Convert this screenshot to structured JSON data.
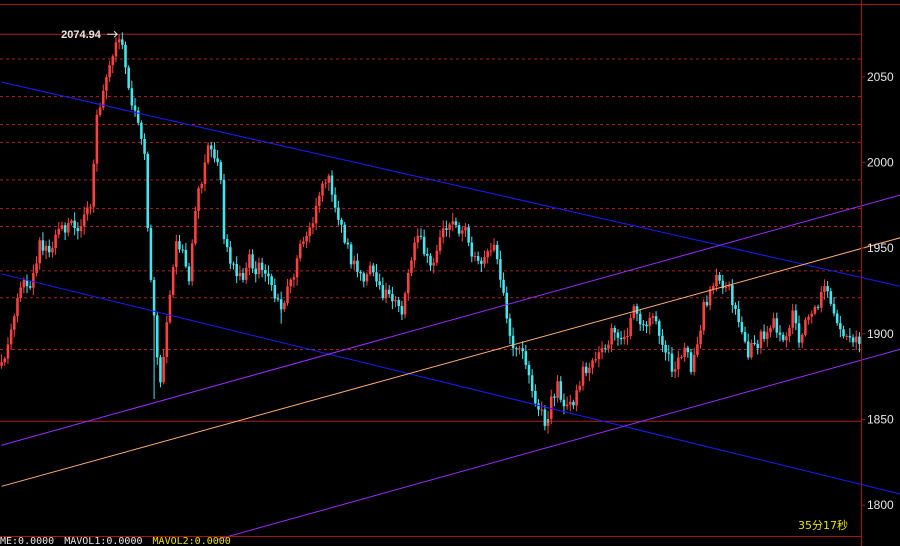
{
  "peak_label": "2074.94",
  "timer": "35分17秒",
  "status_items": [
    {
      "text": "ME:0.0000",
      "color": "#e6e6e6"
    },
    {
      "text": "MAVOL1:0.0000",
      "color": "#e6e6e6"
    },
    {
      "text": "MAVOL2:0.0000",
      "color": "#e8e100"
    }
  ],
  "colors": {
    "background": "#000000",
    "frame": "#aa1111",
    "grid": "#aa2222",
    "up_candle": "#ff4040",
    "down_candle": "#44e6ee",
    "down_channel": "#1a1aff",
    "up_channel": "#9a2bff",
    "mid_channel": "#ffb070"
  },
  "chart_data": {
    "type": "candlestick",
    "ylim": [
      1782,
      2092
    ],
    "y_ticks": [
      {
        "value": 2050,
        "label": "2050"
      },
      {
        "value": 2000,
        "label": "2000"
      },
      {
        "value": 1950,
        "label": "1950"
      },
      {
        "value": 1900,
        "label": "1900"
      },
      {
        "value": 1850,
        "label": "1850"
      },
      {
        "value": 1800,
        "label": "1800"
      }
    ],
    "solid_levels": [
      2074.94,
      1849
    ],
    "dotted_levels": [
      2060.5,
      2038.5,
      2022.2,
      2011.8,
      1989.9,
      1973.1,
      1962.7,
      1936.8,
      1921.1,
      1890.9
    ],
    "peak": {
      "index": 37,
      "value": 2074.94
    },
    "price_path": [
      [
        0,
        1882
      ],
      [
        3,
        1898
      ],
      [
        6,
        1930
      ],
      [
        9,
        1924
      ],
      [
        12,
        1952
      ],
      [
        15,
        1950
      ],
      [
        18,
        1958
      ],
      [
        21,
        1965
      ],
      [
        24,
        1962
      ],
      [
        26,
        1966
      ],
      [
        28,
        1975
      ],
      [
        30,
        2025
      ],
      [
        32,
        2045
      ],
      [
        34,
        2058
      ],
      [
        36,
        2066
      ],
      [
        37,
        2074.94
      ],
      [
        39,
        2058
      ],
      [
        41,
        2030
      ],
      [
        43,
        2025
      ],
      [
        45,
        2002
      ],
      [
        46,
        1960
      ],
      [
        48,
        1910
      ],
      [
        50,
        1870
      ],
      [
        52,
        1905
      ],
      [
        53,
        1925
      ],
      [
        55,
        1955
      ],
      [
        57,
        1945
      ],
      [
        59,
        1935
      ],
      [
        61,
        1975
      ],
      [
        63,
        1992
      ],
      [
        65,
        2012
      ],
      [
        67,
        2005
      ],
      [
        69,
        1990
      ],
      [
        70,
        1955
      ],
      [
        72,
        1940
      ],
      [
        74,
        1938
      ],
      [
        76,
        1932
      ],
      [
        78,
        1945
      ],
      [
        80,
        1935
      ],
      [
        82,
        1940
      ],
      [
        84,
        1930
      ],
      [
        86,
        1925
      ],
      [
        88,
        1913
      ],
      [
        90,
        1925
      ],
      [
        92,
        1935
      ],
      [
        94,
        1948
      ],
      [
        96,
        1960
      ],
      [
        98,
        1963
      ],
      [
        100,
        1980
      ],
      [
        102,
        1992
      ],
      [
        104,
        1985
      ],
      [
        106,
        1967
      ],
      [
        108,
        1955
      ],
      [
        110,
        1943
      ],
      [
        112,
        1937
      ],
      [
        114,
        1935
      ],
      [
        116,
        1938
      ],
      [
        118,
        1928
      ],
      [
        120,
        1920
      ],
      [
        122,
        1925
      ],
      [
        124,
        1922
      ],
      [
        126,
        1910
      ],
      [
        128,
        1934
      ],
      [
        130,
        1952
      ],
      [
        132,
        1955
      ],
      [
        134,
        1945
      ],
      [
        136,
        1940
      ],
      [
        138,
        1958
      ],
      [
        140,
        1962
      ],
      [
        142,
        1968
      ],
      [
        144,
        1962
      ],
      [
        146,
        1958
      ],
      [
        148,
        1945
      ],
      [
        150,
        1940
      ],
      [
        152,
        1945
      ],
      [
        154,
        1952
      ],
      [
        156,
        1945
      ],
      [
        157,
        1936
      ],
      [
        159,
        1910
      ],
      [
        161,
        1895
      ],
      [
        163,
        1895
      ],
      [
        165,
        1880
      ],
      [
        167,
        1868
      ],
      [
        169,
        1856
      ],
      [
        171,
        1848
      ],
      [
        173,
        1860
      ],
      [
        175,
        1868
      ],
      [
        177,
        1860
      ],
      [
        179,
        1856
      ],
      [
        181,
        1865
      ],
      [
        183,
        1878
      ],
      [
        185,
        1880
      ],
      [
        187,
        1885
      ],
      [
        189,
        1890
      ],
      [
        191,
        1897
      ],
      [
        193,
        1905
      ],
      [
        195,
        1897
      ],
      [
        197,
        1900
      ],
      [
        199,
        1915
      ],
      [
        201,
        1907
      ],
      [
        203,
        1905
      ],
      [
        205,
        1912
      ],
      [
        207,
        1895
      ],
      [
        209,
        1890
      ],
      [
        211,
        1880
      ],
      [
        213,
        1887
      ],
      [
        215,
        1888
      ],
      [
        217,
        1882
      ],
      [
        219,
        1895
      ],
      [
        221,
        1915
      ],
      [
        223,
        1922
      ],
      [
        225,
        1930
      ],
      [
        227,
        1927
      ],
      [
        229,
        1925
      ],
      [
        231,
        1912
      ],
      [
        233,
        1900
      ],
      [
        235,
        1890
      ],
      [
        237,
        1892
      ],
      [
        239,
        1900
      ],
      [
        241,
        1898
      ],
      [
        243,
        1905
      ],
      [
        245,
        1896
      ],
      [
        247,
        1902
      ],
      [
        249,
        1910
      ],
      [
        251,
        1897
      ],
      [
        253,
        1905
      ],
      [
        255,
        1910
      ],
      [
        257,
        1918
      ],
      [
        259,
        1925
      ],
      [
        261,
        1920
      ],
      [
        263,
        1910
      ],
      [
        265,
        1900
      ],
      [
        267,
        1898
      ],
      [
        269,
        1900
      ],
      [
        270,
        1893
      ]
    ],
    "trend_lines": [
      {
        "color": "down_channel",
        "p1": [
          0,
          2047
        ],
        "p2": [
          306,
          1918
        ]
      },
      {
        "color": "down_channel",
        "p1": [
          0,
          1935
        ],
        "p2": [
          306,
          1796
        ]
      },
      {
        "color": "up_channel",
        "p1": [
          0,
          1835
        ],
        "p2": [
          306,
          1993
        ]
      },
      {
        "color": "up_channel",
        "p1": [
          68,
          1780
        ],
        "p2": [
          306,
          1903
        ]
      },
      {
        "color": "mid_channel",
        "p1": [
          0,
          1811
        ],
        "p2": [
          306,
          1968
        ]
      }
    ]
  }
}
